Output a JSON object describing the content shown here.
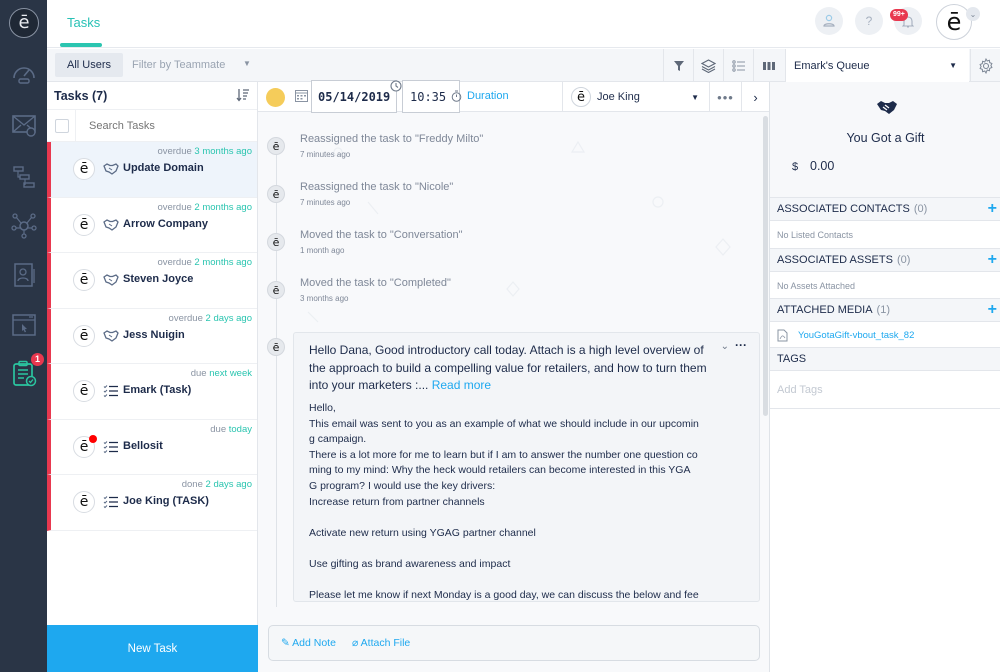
{
  "app": {
    "top_tab": "Tasks",
    "notification_badge": "99+",
    "task_nav_badge": "1",
    "brand_glyph": "ē"
  },
  "nav": {
    "items": [
      {
        "name": "dashboard",
        "icon": "speedometer-icon"
      },
      {
        "name": "email",
        "icon": "envelope-icon"
      },
      {
        "name": "workflow",
        "icon": "flow-icon"
      },
      {
        "name": "network",
        "icon": "network-icon"
      },
      {
        "name": "contacts",
        "icon": "contact-card-icon"
      },
      {
        "name": "web",
        "icon": "browser-cursor-icon"
      },
      {
        "name": "tasks",
        "icon": "clipboard-icon",
        "active": true
      }
    ]
  },
  "filterbar": {
    "all_users": "All Users",
    "filter_placeholder": "Filter by Teammate",
    "queue": "Emark's Queue"
  },
  "tasklist": {
    "title": "Tasks (7)",
    "search_placeholder": "Search Tasks",
    "new_task": "New Task",
    "tasks": [
      {
        "status": "overdue",
        "when": "3 months ago",
        "type": "deal",
        "name": "Update Domain",
        "active": true,
        "dot": false
      },
      {
        "status": "overdue",
        "when": "2 months ago",
        "type": "deal",
        "name": "Arrow Company",
        "active": false,
        "dot": false
      },
      {
        "status": "overdue",
        "when": "2 months ago",
        "type": "deal",
        "name": "Steven Joyce",
        "active": false,
        "dot": false
      },
      {
        "status": "overdue",
        "when": "2 days ago",
        "type": "deal",
        "name": "Jess Nuigin",
        "active": false,
        "dot": false
      },
      {
        "status": "due",
        "when": "next week",
        "type": "checklist",
        "name": "Emark (Task)",
        "active": false,
        "dot": false
      },
      {
        "status": "due",
        "when": "today",
        "type": "checklist",
        "name": "Bellosit",
        "active": false,
        "dot": true
      },
      {
        "status": "done",
        "when": "2 days ago",
        "type": "checklist",
        "name": "Joe King (TASK)",
        "active": false,
        "dot": false
      }
    ]
  },
  "detail": {
    "date": "05/14/2019",
    "time": "10:35",
    "duration_label": "Duration",
    "assignee": "Joe King",
    "events": [
      {
        "text": "Reassigned the task to \"Freddy Milto\"",
        "ago": "7 minutes ago"
      },
      {
        "text": "Reassigned the task to \"Nicole\"",
        "ago": "7 minutes ago"
      },
      {
        "text": "Moved the task to \"Conversation\"",
        "ago": "1 month ago"
      },
      {
        "text": "Moved the task to \"Completed\"",
        "ago": "3 months ago"
      }
    ],
    "email": {
      "summary": "Hello Dana, Good introductory call today. Attach is a high level overview of the approach to build a compelling value for retailers, and how to turn them into your marketers :...",
      "read_more": "Read more",
      "body_lines": [
        "Hello,",
        "This email was sent to you as an example of what we should include in our upcomin",
        "g campaign.",
        "There is a lot more for me to learn but if I am to answer the number one question co",
        "ming to my mind: Why the heck would retailers can become interested in this YGA",
        "G program? I would use the key drivers:",
        "Increase return from partner channels",
        "",
        "Activate new return using YGAG partner channel",
        "",
        "Use gifting as brand awareness and impact",
        "",
        "Please let me know if next Monday is a good day, we can discuss the below and fee"
      ]
    },
    "composer": {
      "add_note": "Add Note",
      "attach_file": "Attach File"
    }
  },
  "rpanel": {
    "gift_title": "You Got a Gift",
    "currency": "$",
    "amount": "0.00",
    "contacts_title": "ASSOCIATED CONTACTS",
    "contacts_count": "(0)",
    "contacts_empty": "No Listed Contacts",
    "assets_title": "ASSOCIATED ASSETS",
    "assets_count": "(0)",
    "assets_empty": "No Assets Attached",
    "media_title": "ATTACHED MEDIA",
    "media_count": "(1)",
    "media_file": "YouGotaGift-vbout_task_82",
    "tags_title": "TAGS",
    "tags_placeholder": "Add Tags"
  },
  "colors": {
    "accent_teal": "#2bc5b0",
    "accent_blue": "#1ea8ef",
    "overdue_red": "#e8384f",
    "nav_bg": "#2a3546"
  }
}
